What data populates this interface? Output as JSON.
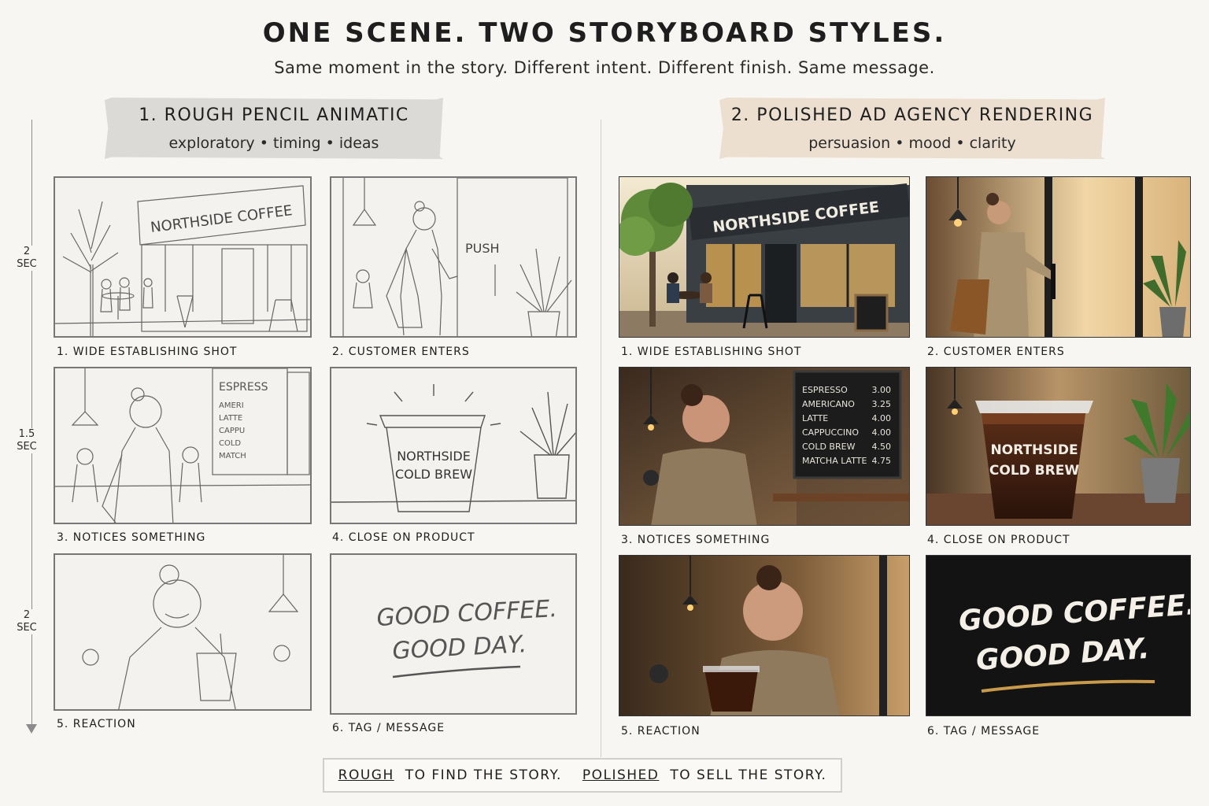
{
  "header": {
    "title": "ONE SCENE.  TWO STORYBOARD STYLES.",
    "subtitle": "Same moment in the story. Different intent. Different finish. Same message."
  },
  "timeline": {
    "segments": [
      "2",
      "SEC",
      "1.5",
      "SEC",
      "2",
      "SEC"
    ]
  },
  "rough": {
    "heading": "1. ROUGH PENCIL ANIMATIC",
    "tagline": "exploratory • timing • ideas",
    "sign": "NORTHSIDE COFFEE",
    "push_label": "PUSH",
    "menu_board": [
      "ESPRESS",
      "AMERI",
      "LATTE",
      "CAPPU",
      "COLD",
      "MATCH"
    ],
    "cup_text": [
      "NORTHSIDE",
      "COLD BREW"
    ],
    "tag_text": [
      "GOOD COFFEE.",
      "GOOD DAY."
    ],
    "captions": [
      "1. WIDE ESTABLISHING SHOT",
      "2. CUSTOMER ENTERS",
      "3. NOTICES SOMETHING",
      "4. CLOSE ON PRODUCT",
      "5. REACTION",
      "6. TAG / MESSAGE"
    ]
  },
  "polished": {
    "heading": "2. POLISHED AD AGENCY RENDERING",
    "tagline": "persuasion • mood • clarity",
    "sign": "NORTHSIDE COFFEE",
    "menu": [
      {
        "item": "ESPRESSO",
        "price": "3.00"
      },
      {
        "item": "AMERICANO",
        "price": "3.25"
      },
      {
        "item": "LATTE",
        "price": "4.00"
      },
      {
        "item": "CAPPUCCINO",
        "price": "4.00"
      },
      {
        "item": "COLD BREW",
        "price": "4.50"
      },
      {
        "item": "MATCHA LATTE",
        "price": "4.75"
      }
    ],
    "cup_text": [
      "NORTHSIDE",
      "COLD BREW"
    ],
    "tag_text": [
      "GOOD COFFEE.",
      "GOOD DAY."
    ],
    "captions": [
      "1. WIDE ESTABLISHING SHOT",
      "2. CUSTOMER ENTERS",
      "3. NOTICES SOMETHING",
      "4. CLOSE ON PRODUCT",
      "5. REACTION",
      "6. TAG / MESSAGE"
    ]
  },
  "footer": {
    "rough_word": "ROUGH",
    "rough_rest": "TO FIND THE STORY.",
    "polished_word": "POLISHED",
    "polished_rest": "TO SELL THE STORY."
  }
}
